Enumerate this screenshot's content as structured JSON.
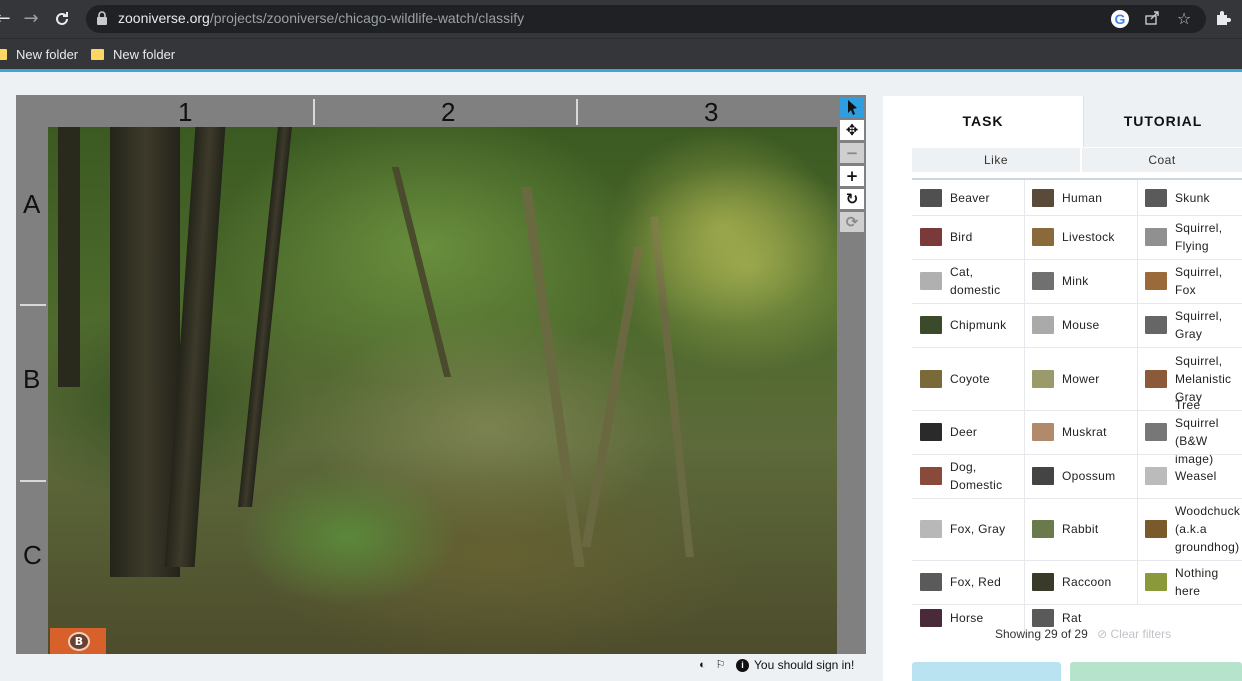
{
  "browser": {
    "url_host": "zooniverse.org",
    "url_path": "/projects/zooniverse/chicago-wildlife-watch/classify",
    "bookmarks": [
      "New folder",
      "New folder"
    ],
    "icons": [
      "back-arrow-icon",
      "forward-arrow-icon",
      "reload-icon",
      "lock-icon",
      "google-icon",
      "share-icon",
      "star-icon",
      "extensions-icon"
    ]
  },
  "viewer": {
    "columns": [
      "1",
      "2",
      "3"
    ],
    "rows": [
      "A",
      "B",
      "C"
    ],
    "tools": [
      "pointer-icon",
      "move-icon",
      "zoom-out-icon",
      "zoom-in-icon",
      "rotate-icon",
      "reset-icon"
    ],
    "logo_text": "B"
  },
  "footer": {
    "sign_in": "You should sign in!",
    "icons": [
      "contrast-icon",
      "flag-icon",
      "info-icon"
    ]
  },
  "panel": {
    "tabs": [
      "TASK",
      "TUTORIAL"
    ],
    "filters": [
      "Like",
      "Coat"
    ],
    "choices": [
      [
        "Beaver",
        "Human",
        "Skunk"
      ],
      [
        "Bird",
        "Livestock",
        "Squirrel, Flying"
      ],
      [
        "Cat, domestic",
        "Mink",
        "Squirrel, Fox"
      ],
      [
        "Chipmunk",
        "Mouse",
        "Squirrel, Gray"
      ],
      [
        "Coyote",
        "Mower",
        "Squirrel, Melanistic Gray"
      ],
      [
        "Deer",
        "Muskrat",
        "Tree Squirrel (B&W image)"
      ],
      [
        "Dog, Domestic",
        "Opossum",
        "Weasel"
      ],
      [
        "Fox, Gray",
        "Rabbit",
        "Woodchuck (a.k.a groundhog)"
      ],
      [
        "Fox, Red",
        "Raccoon",
        "Nothing here"
      ],
      [
        "Horse",
        "Rat"
      ]
    ],
    "showing": "Showing 29 of 29",
    "clear_filters": "Clear filters",
    "colors": {
      "accent": "#3ca6d6",
      "tool_active": "#2f9ee0",
      "done_button": "#7fd0e8",
      "done_talk_button": "#7fcfa8"
    }
  }
}
